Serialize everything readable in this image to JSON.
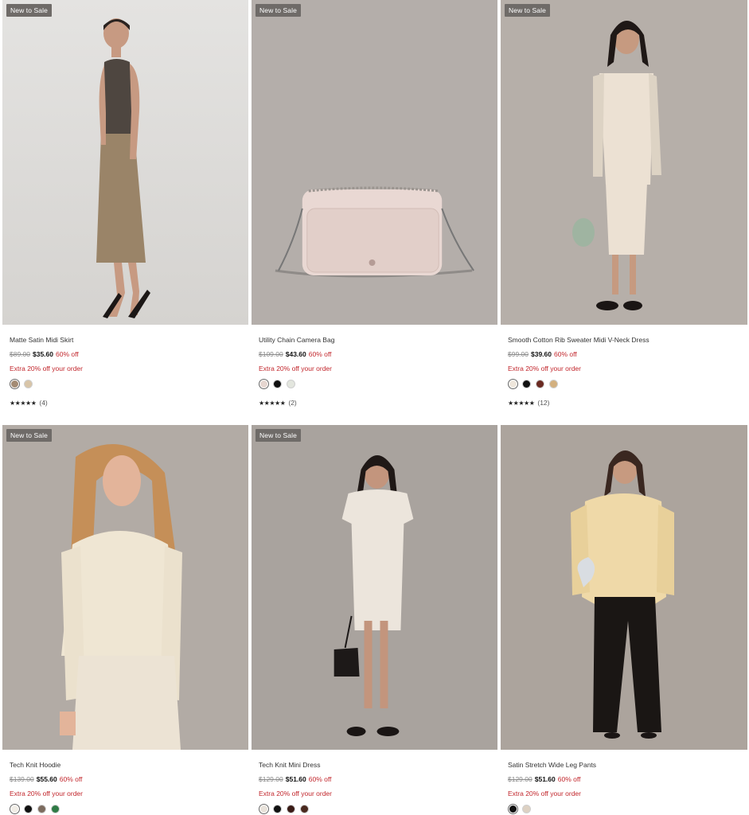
{
  "products": [
    {
      "badge": "New to Sale",
      "name": "Matte Satin Midi Skirt",
      "orig_price": "$89.00",
      "sale_price": "$35.60",
      "discount": "60% off",
      "promo": "Extra 20% off your order",
      "swatches": [
        "#a38b74",
        "#d8c5a8"
      ],
      "selected_swatch": 0,
      "stars": "★★★★★",
      "review_count": "(4)",
      "image": "model-brown-tank-khaki-skirt"
    },
    {
      "badge": "New to Sale",
      "name": "Utility Chain Camera Bag",
      "orig_price": "$109.00",
      "sale_price": "$43.60",
      "discount": "60% off",
      "promo": "Extra 20% off your order",
      "swatches": [
        "#e6d6d0",
        "#111111",
        "#e3e6de"
      ],
      "selected_swatch": 0,
      "stars": "★★★★★",
      "review_count": "(2)",
      "image": "pink-chain-camera-bag"
    },
    {
      "badge": "New to Sale",
      "name": "Smooth Cotton Rib Sweater Midi V-Neck Dress",
      "orig_price": "$99.00",
      "sale_price": "$39.60",
      "discount": "60% off",
      "promo": "Extra 20% off your order",
      "swatches": [
        "#efe7dc",
        "#111111",
        "#6a2a22",
        "#d3b07f"
      ],
      "selected_swatch": 0,
      "stars": "★★★★★",
      "review_count": "(12)",
      "image": "model-cream-rib-dress"
    },
    {
      "badge": "New to Sale",
      "name": "Tech Knit Hoodie",
      "orig_price": "$139.00",
      "sale_price": "$55.60",
      "discount": "60% off",
      "promo": "Extra 20% off your order",
      "swatches": [
        "#f1ede6",
        "#111111",
        "#7c6b5e",
        "#2f7a45"
      ],
      "selected_swatch": 0,
      "image": "model-cream-knit-hoodie"
    },
    {
      "badge": "New to Sale",
      "name": "Tech Knit Mini Dress",
      "orig_price": "$129.00",
      "sale_price": "$51.60",
      "discount": "60% off",
      "promo": "Extra 20% off your order",
      "swatches": [
        "#e8e2da",
        "#111111",
        "#3a1b16",
        "#4a2a1f"
      ],
      "selected_swatch": 0,
      "image": "model-cream-mini-dress"
    },
    {
      "name": "Satin Stretch Wide Leg Pants",
      "orig_price": "$129.00",
      "sale_price": "$51.60",
      "discount": "60% off",
      "promo": "Extra 20% off your order",
      "swatches": [
        "#111111",
        "#ddd1c3"
      ],
      "selected_swatch": 0,
      "image": "model-yellow-shirt-black-pants"
    }
  ]
}
